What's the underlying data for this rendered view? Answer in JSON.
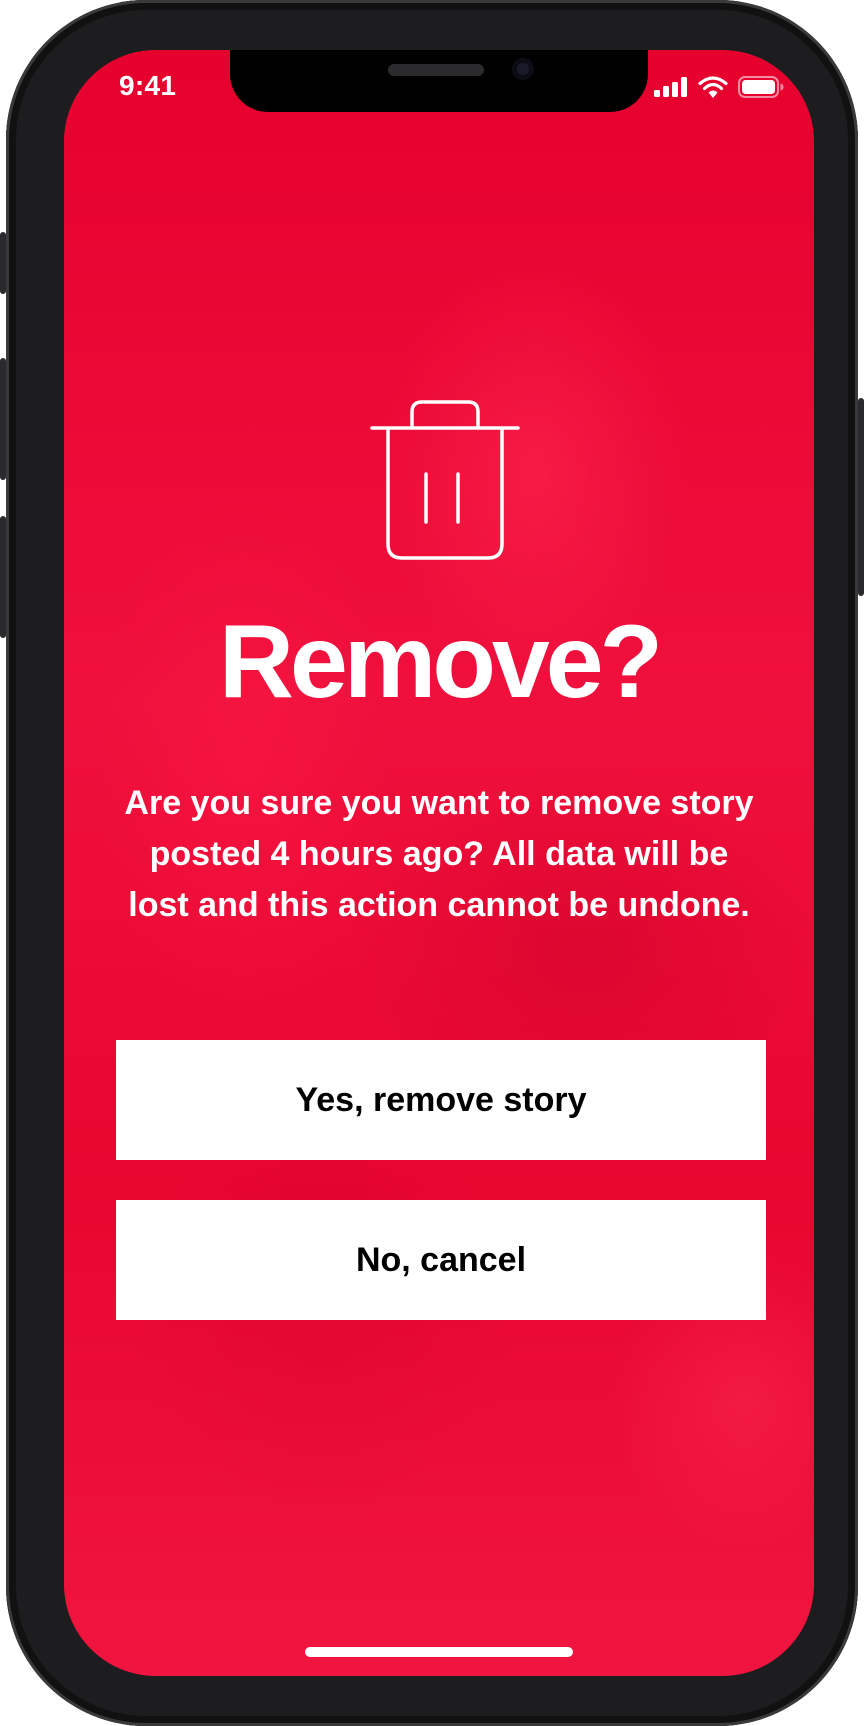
{
  "status_bar": {
    "time": "9:41",
    "icons": [
      "cellular-signal-icon",
      "wifi-icon",
      "battery-icon"
    ]
  },
  "dialog": {
    "icon": "trash-icon",
    "title": "Remove?",
    "message": "Are you sure you want to remove story posted 4 hours ago? All data will be lost and this action cannot be undone.",
    "confirm_label": "Yes, remove story",
    "cancel_label": "No, cancel"
  },
  "colors": {
    "accent": "#E8002F",
    "button_bg": "#FFFFFF",
    "button_text": "#000000",
    "text": "#FFFFFF"
  }
}
